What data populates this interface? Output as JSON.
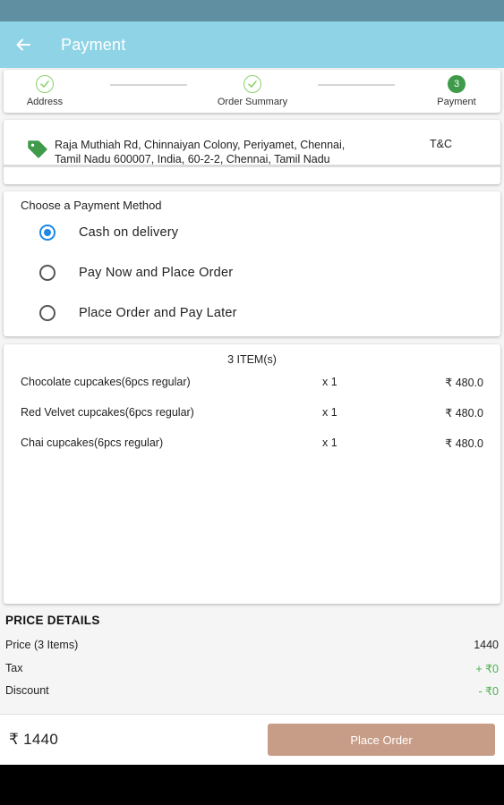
{
  "app_bar": {
    "title": "Payment"
  },
  "stepper": {
    "steps": [
      {
        "label": "Address",
        "state": "done"
      },
      {
        "label": "Order Summary",
        "state": "done"
      },
      {
        "label": "Payment",
        "state": "active",
        "number": "3"
      }
    ]
  },
  "address": {
    "text": "Raja Muthiah Rd, Chinnaiyan Colony, Periyamet, Chennai, Tamil Nadu 600007, India, 60-2-2, Chennai, Tamil Nadu",
    "terms_link": "T&C"
  },
  "payment": {
    "title": "Choose a Payment Method",
    "options": [
      {
        "label": "Cash on delivery",
        "selected": true
      },
      {
        "label": "Pay Now and Place Order",
        "selected": false
      },
      {
        "label": "Place Order and Pay Later",
        "selected": false
      }
    ]
  },
  "items": {
    "count_label": "3 ITEM(s)",
    "list": [
      {
        "name": "Chocolate cupcakes(6pcs regular)",
        "qty": "x 1",
        "price": "₹ 480.0"
      },
      {
        "name": "Red Velvet cupcakes(6pcs regular)",
        "qty": "x 1",
        "price": "₹ 480.0"
      },
      {
        "name": "Chai cupcakes(6pcs regular)",
        "qty": "x 1",
        "price": "₹ 480.0"
      }
    ]
  },
  "price_details": {
    "title": "PRICE DETAILS",
    "price_label": "Price (3 Items)",
    "price_value": "1440",
    "tax_label": "Tax",
    "tax_value": "+ ₹0",
    "discount_label": "Discount",
    "discount_value": "- ₹0"
  },
  "bottom_bar": {
    "total": "₹ 1440",
    "place_order_label": "Place Order"
  },
  "colors": {
    "app_bar": "#8fd4e6",
    "status_bar": "#5f8fa1",
    "accent_green": "#3f9a4a",
    "radio_selected": "#1e88e5",
    "button": "#c79d88"
  },
  "icons": {
    "back": "arrow-left-icon",
    "address_tag": "tag-icon",
    "step_done": "check-circle-icon"
  }
}
